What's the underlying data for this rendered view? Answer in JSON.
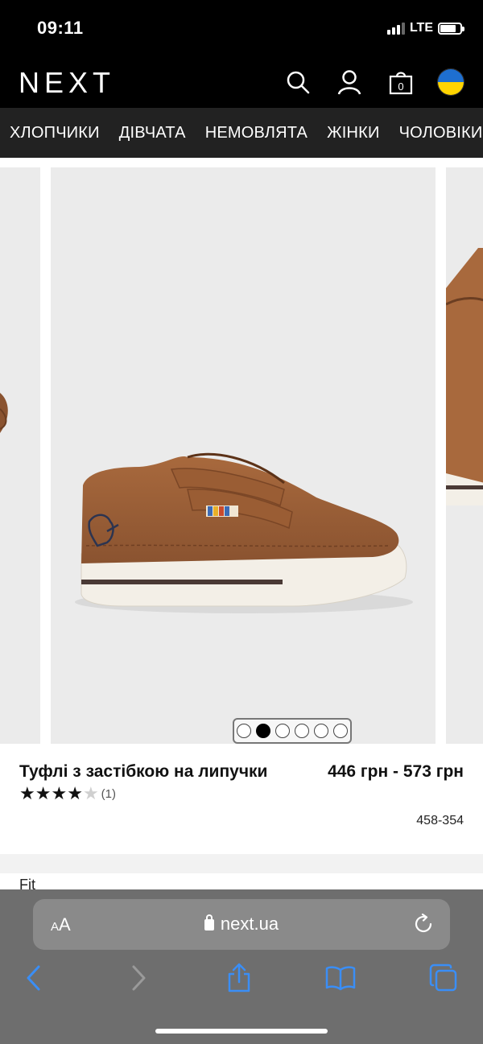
{
  "status_bar": {
    "time": "09:11",
    "network": "LTE",
    "battery_level": 0.8
  },
  "header": {
    "logo": "NEXT",
    "bag_count": "0",
    "icons": [
      "search-icon",
      "account-icon",
      "bag-icon",
      "ukraine-flag-icon"
    ],
    "flag_colors": [
      "#1e6fd0",
      "#ffd400"
    ]
  },
  "nav": {
    "items": [
      "ХЛОПЧИКИ",
      "ДІВЧАТА",
      "НЕМОВЛЯТА",
      "ЖІНКИ",
      "ЧОЛОВІКИ"
    ]
  },
  "carousel": {
    "slide_count": 6,
    "active_index": 1
  },
  "product": {
    "title": "Туфлі з застібкою на липучки",
    "rating": 4,
    "rating_max": 5,
    "rating_count": "(1)",
    "price": "446 грн - 573 грн",
    "sku": "458-354"
  },
  "section": {
    "fit_label": "Fit"
  },
  "browser": {
    "aa_label": "AA",
    "url": "next.ua",
    "icons": [
      "back-icon",
      "forward-icon",
      "share-icon",
      "bookmarks-icon",
      "tabs-icon",
      "reload-icon",
      "lock-icon"
    ]
  },
  "colors": {
    "header_bg": "#000000",
    "nav_bg": "#222222",
    "browser_bar_bg": "#6e6e6e",
    "accent_blue": "#3a8ef6"
  }
}
